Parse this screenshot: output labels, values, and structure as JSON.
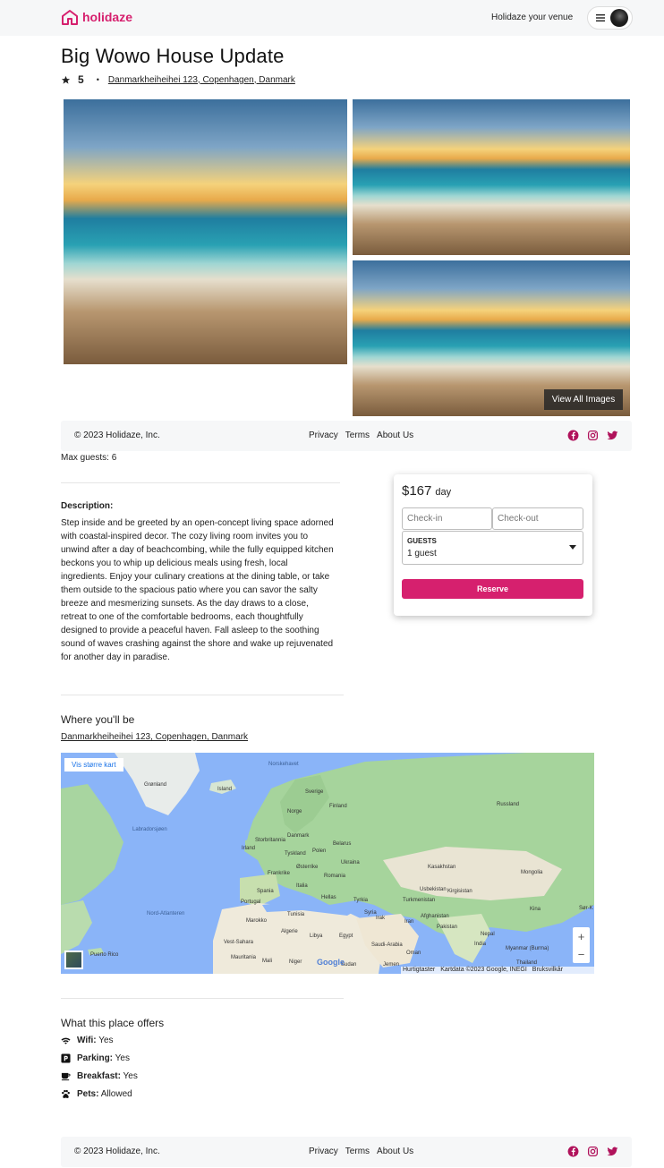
{
  "header": {
    "brand": "holidaze",
    "host_link": "Holidaze your venue",
    "menu_icon": "hamburger-icon",
    "avatar_icon": "avatar"
  },
  "venue": {
    "title": "Big Wowo House Update",
    "rating": "5",
    "separator": "•",
    "address": "Danmarkheiheihei 123, Copenhagen, Danmark",
    "view_all_images": "View All Images",
    "max_guests": "Max guests: 6",
    "description_label": "Description:",
    "description": "Step inside and be greeted by an open-concept living space adorned with coastal-inspired decor. The cozy living room invites you to unwind after a day of beachcombing, while the fully equipped kitchen beckons you to whip up delicious meals using fresh, local ingredients. Enjoy your culinary creations at the dining table, or take them outside to the spacious patio where you can savor the salty breeze and mesmerizing sunsets. As the day draws to a close, retreat to one of the comfortable bedrooms, each thoughtfully designed to provide a peaceful haven. Fall asleep to the soothing sound of waves crashing against the shore and wake up rejuvenated for another day in paradise."
  },
  "booking": {
    "price": "$167",
    "per": "day",
    "checkin_placeholder": "Check-in",
    "checkout_placeholder": "Check-out",
    "guests_label": "GUESTS",
    "guests_value": "1 guest",
    "reserve_label": "Reserve"
  },
  "location": {
    "title": "Where you'll be",
    "address": "Danmarkheiheihei 123, Copenhagen, Danmark",
    "map": {
      "larger_map_label": "Vis større kart",
      "zoom_in": "+",
      "zoom_out": "−",
      "google": "Google",
      "shortcuts": "Hurtigtaster",
      "map_data": "Kartdata ©2023 Google, INEGI",
      "terms": "Bruksvilkår",
      "labels": [
        "Grønland",
        "Island",
        "Sverige",
        "Finland",
        "Norge",
        "Russland",
        "Labradorsjøen",
        "Storbritannia",
        "Danmark",
        "Irland",
        "Belarus",
        "Tyskland",
        "Polen",
        "Ukraina",
        "Frankrike",
        "Østerrike",
        "Romania",
        "Kasakhstan",
        "Mongolia",
        "Spania",
        "Italia",
        "Portugal",
        "Hellas",
        "Tyrkia",
        "Usbekistan",
        "Kirgisistan",
        "Turkmenistan",
        "Nord-Atlanteren",
        "Marokko",
        "Tunisia",
        "Syria",
        "Irak",
        "Iran",
        "Afghanistan",
        "Kina",
        "Sør-K",
        "Algerie",
        "Libya",
        "Egypt",
        "Pakistan",
        "Vest-Sahara",
        "Mauritania",
        "Mali",
        "Niger",
        "Saudi-Arabia",
        "Nepal",
        "India",
        "Myanmar (Burma)",
        "Puerto Rico",
        "Sudan",
        "Jemen",
        "Oman",
        "Thailand",
        "Norskehavet"
      ]
    }
  },
  "offers": {
    "title": "What this place offers",
    "items": [
      {
        "icon": "wifi-icon",
        "label": "Wifi:",
        "value": "Yes"
      },
      {
        "icon": "parking-icon",
        "label": "Parking:",
        "value": "Yes"
      },
      {
        "icon": "coffee-icon",
        "label": "Breakfast:",
        "value": "Yes"
      },
      {
        "icon": "paw-icon",
        "label": "Pets:",
        "value": "Allowed"
      }
    ]
  },
  "footer": {
    "copyright": "© 2023 Holidaze, Inc.",
    "links": [
      "Privacy",
      "Terms",
      "About Us"
    ],
    "socials": [
      "facebook-icon",
      "instagram-icon",
      "twitter-icon"
    ]
  },
  "colors": {
    "brand": "#d6206e",
    "social": "#b0125b",
    "header_bg": "#f6f7f8"
  }
}
